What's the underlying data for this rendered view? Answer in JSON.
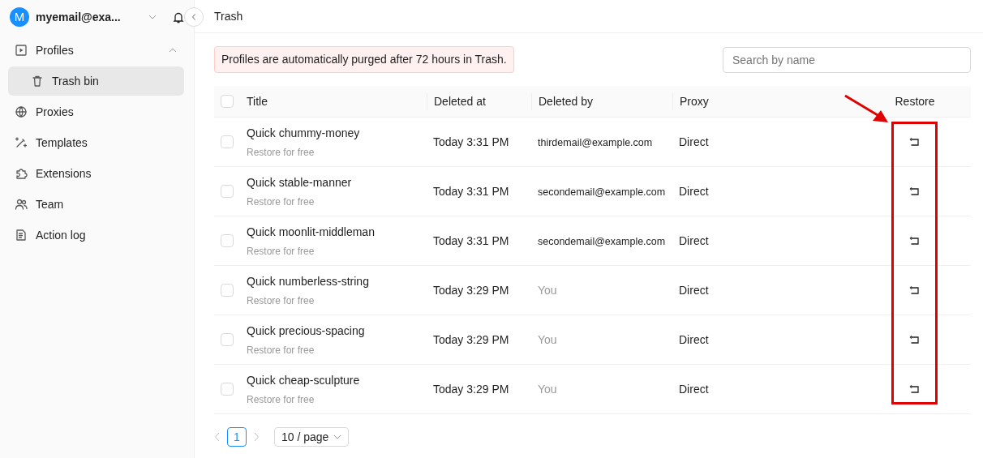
{
  "account": {
    "avatar": "M",
    "email": "myemail@exa..."
  },
  "sidebar": {
    "items": [
      {
        "label": "Profiles",
        "selected": false,
        "expanded": true,
        "children": [
          {
            "label": "Trash bin",
            "selected": true
          }
        ]
      },
      {
        "label": "Proxies",
        "selected": false
      },
      {
        "label": "Templates",
        "selected": false
      },
      {
        "label": "Extensions",
        "selected": false
      },
      {
        "label": "Team",
        "selected": false
      },
      {
        "label": "Action log",
        "selected": false
      }
    ]
  },
  "page": {
    "title": "Trash"
  },
  "notice": "Profiles are automatically purged after 72 hours in Trash.",
  "search": {
    "placeholder": "Search by name"
  },
  "table": {
    "all_checked": false,
    "columns": [
      "Title",
      "Deleted at",
      "Deleted by",
      "Proxy",
      "Restore"
    ],
    "rows": [
      {
        "checked": false,
        "title": "Quick chummy-money",
        "subtitle": "Restore for free",
        "deleted_at": "Today 3:31 PM",
        "deleted_by": "thirdemail@example.com",
        "by_self": false,
        "proxy": "Direct"
      },
      {
        "checked": false,
        "title": "Quick stable-manner",
        "subtitle": "Restore for free",
        "deleted_at": "Today 3:31 PM",
        "deleted_by": "secondemail@example.com",
        "by_self": false,
        "proxy": "Direct"
      },
      {
        "checked": false,
        "title": "Quick moonlit-middleman",
        "subtitle": "Restore for free",
        "deleted_at": "Today 3:31 PM",
        "deleted_by": "secondemail@example.com",
        "by_self": false,
        "proxy": "Direct"
      },
      {
        "checked": false,
        "title": "Quick numberless-string",
        "subtitle": "Restore for free",
        "deleted_at": "Today 3:29 PM",
        "deleted_by": "You",
        "by_self": true,
        "proxy": "Direct"
      },
      {
        "checked": false,
        "title": "Quick precious-spacing",
        "subtitle": "Restore for free",
        "deleted_at": "Today 3:29 PM",
        "deleted_by": "You",
        "by_self": true,
        "proxy": "Direct"
      },
      {
        "checked": false,
        "title": "Quick cheap-sculpture",
        "subtitle": "Restore for free",
        "deleted_at": "Today 3:29 PM",
        "deleted_by": "You",
        "by_self": true,
        "proxy": "Direct"
      }
    ]
  },
  "pagination": {
    "pages": [
      {
        "label": "1",
        "selected": true
      }
    ],
    "page_size": "10 / page"
  }
}
